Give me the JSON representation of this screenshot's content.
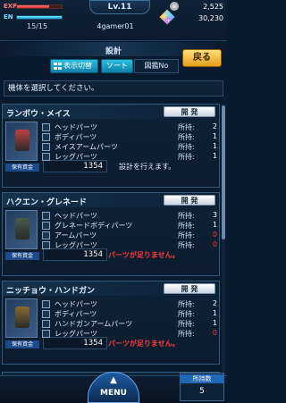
{
  "header": {
    "exp_label": "EXP",
    "en_label": "EN",
    "energy": "15/15",
    "level": "Lv.11",
    "player_name": "4gamer01",
    "coins": "2,525",
    "gems": "30,230",
    "gem_plus": "+",
    "exp_progress": 0.72,
    "energy_progress": 1.0
  },
  "screen": {
    "title": "設計",
    "back_label": "戻る",
    "display_toggle": "表示切替",
    "sort_label": "ソート",
    "sort_value": "図鑑No",
    "instruction": "機体を選択してください。"
  },
  "labels": {
    "develop": "開 発",
    "owned": "所持:",
    "stock": "保有資金"
  },
  "cards": [
    {
      "name": "ランボウ・メイス",
      "cost": "1354",
      "status": "設計を行えます。",
      "status_ok": true,
      "thumb_color": "#c04040",
      "parts": [
        {
          "icon": "head-part-icon",
          "name": "ヘッドパーツ",
          "owned": "2",
          "short": false
        },
        {
          "icon": "body-part-icon",
          "name": "ボディパーツ",
          "owned": "1",
          "short": false
        },
        {
          "icon": "arm-part-icon",
          "name": "メイスアームパーツ",
          "owned": "1",
          "short": false
        },
        {
          "icon": "leg-part-icon",
          "name": "レッグパーツ",
          "owned": "1",
          "short": false
        }
      ]
    },
    {
      "name": "ハクエン・グレネード",
      "cost": "1354",
      "status": "パーツが足りません。",
      "status_ok": false,
      "thumb_color": "#4a5a48",
      "parts": [
        {
          "icon": "head-part-icon",
          "name": "ヘッドパーツ",
          "owned": "3",
          "short": false
        },
        {
          "icon": "body-part-icon",
          "name": "グレネードボディパーツ",
          "owned": "1",
          "short": false
        },
        {
          "icon": "arm-part-icon",
          "name": "アームパーツ",
          "owned": "0",
          "short": true
        },
        {
          "icon": "leg-part-icon",
          "name": "レッグパーツ",
          "owned": "0",
          "short": true
        }
      ]
    },
    {
      "name": "ニッチョウ・ハンドガン",
      "cost": "1354",
      "status": "パーツが足りません。",
      "status_ok": false,
      "thumb_color": "#8a6a30",
      "parts": [
        {
          "icon": "head-part-icon",
          "name": "ヘッドパーツ",
          "owned": "2",
          "short": false
        },
        {
          "icon": "body-part-icon",
          "name": "ボディパーツ",
          "owned": "1",
          "short": false
        },
        {
          "icon": "arm-part-icon",
          "name": "ハンドガンアームパーツ",
          "owned": "1",
          "short": false
        },
        {
          "icon": "leg-part-icon",
          "name": "レッグパーツ",
          "owned": "0",
          "short": true
        }
      ]
    }
  ],
  "footer": {
    "menu_label": "MENU",
    "owned_count_label": "所持数",
    "owned_count": "5"
  },
  "colors": {
    "accent_orange": "#e59e1b",
    "accent_cyan": "#2bc0e0",
    "danger": "#ff3a3a"
  }
}
